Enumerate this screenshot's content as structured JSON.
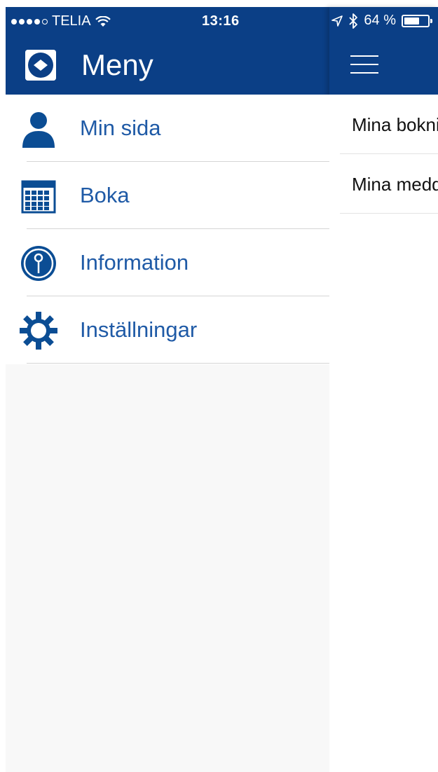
{
  "status_bar": {
    "carrier": "TELIA",
    "time": "13:16",
    "battery_percent": "64 %",
    "battery_level": 0.64,
    "signal_bars_filled": 4,
    "signal_bars_total": 5
  },
  "menu": {
    "title": "Meny",
    "items": [
      {
        "label": "Min sida",
        "icon": "person-icon"
      },
      {
        "label": "Boka",
        "icon": "calendar-icon"
      },
      {
        "label": "Information",
        "icon": "info-icon"
      },
      {
        "label": "Inställningar",
        "icon": "gear-icon"
      }
    ]
  },
  "main": {
    "items": [
      {
        "label": "Mina bokningar"
      },
      {
        "label": "Mina meddelanden"
      }
    ]
  },
  "colors": {
    "header_blue": "#0b3f86",
    "menu_text_blue": "#1f5aa6",
    "icon_blue": "#0b4d94"
  }
}
